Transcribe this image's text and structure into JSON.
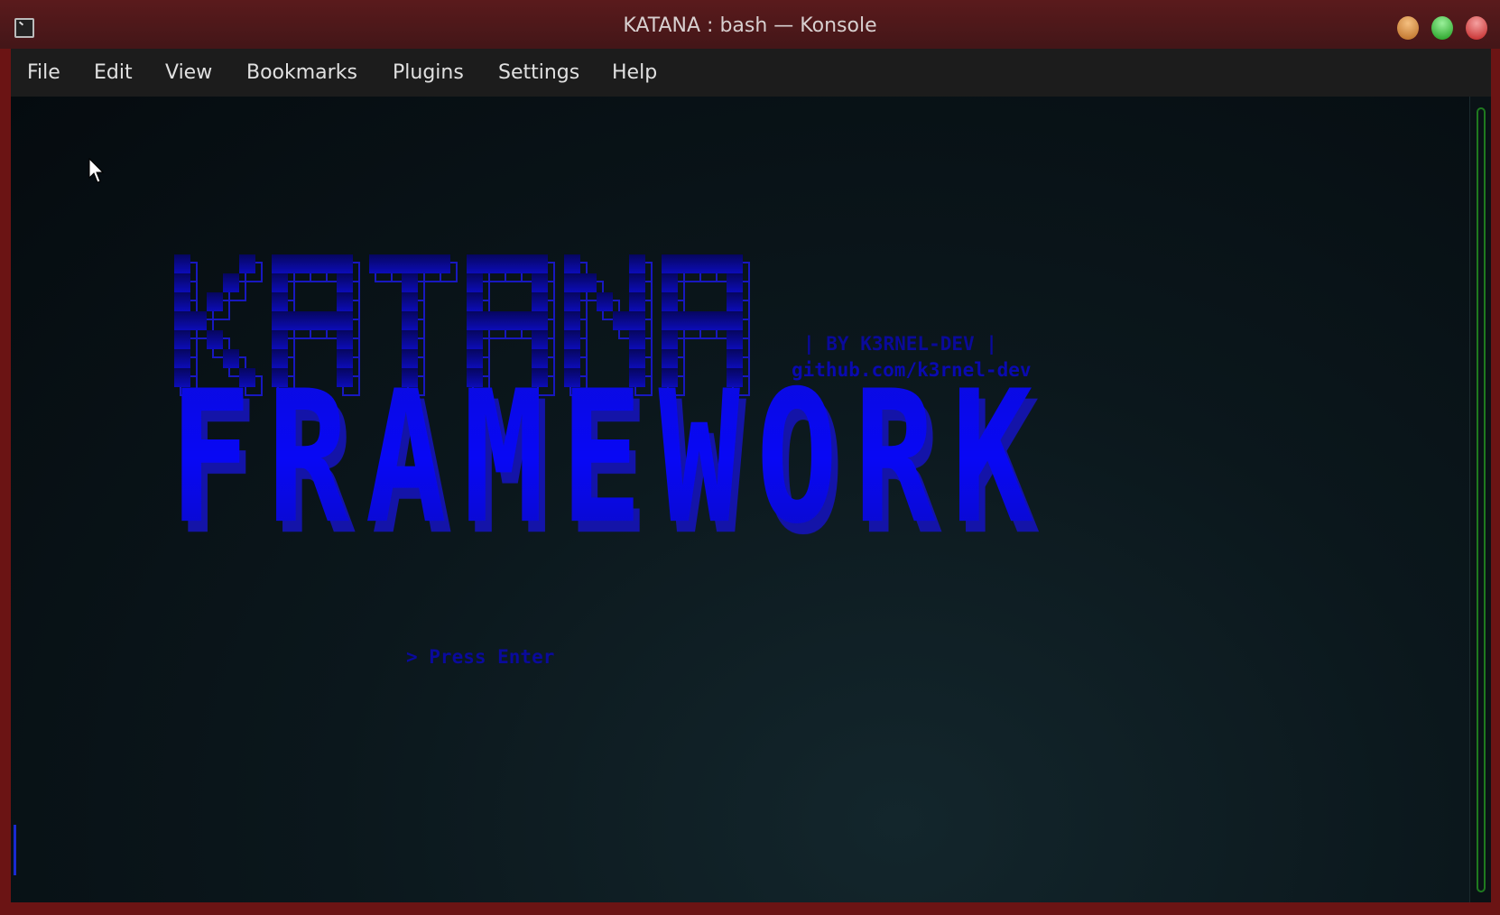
{
  "window": {
    "title": "KATANA : bash — Konsole",
    "icon": "terminal-icon",
    "buttons": [
      {
        "name": "minimize",
        "color": "#d08a30"
      },
      {
        "name": "maximize",
        "color": "#2fb52f"
      },
      {
        "name": "close",
        "color": "#d83a3a"
      }
    ]
  },
  "menu": [
    "File",
    "Edit",
    "View",
    "Bookmarks",
    "Plugins",
    "Settings",
    "Help"
  ],
  "terminal": {
    "banner_line1": "KATANA",
    "banner_line2": "FRAMEWORK",
    "byline": "| BY K3RNEL-DEV |",
    "link": "github.com/k3rnel-dev",
    "prompt": "> Press Enter",
    "colors": {
      "banner_top": "#08087a",
      "banner_bottom": "#0a0af0",
      "text": "#0a0ab0"
    }
  }
}
